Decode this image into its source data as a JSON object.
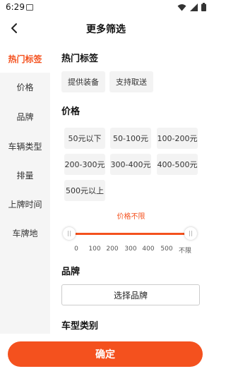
{
  "status": {
    "time": "6:29"
  },
  "header": {
    "title": "更多筛选"
  },
  "sidebar": {
    "items": [
      {
        "label": "热门标签",
        "active": true
      },
      {
        "label": "价格"
      },
      {
        "label": "品牌"
      },
      {
        "label": "车辆类型"
      },
      {
        "label": "排量"
      },
      {
        "label": "上牌时间"
      },
      {
        "label": "车牌地"
      }
    ]
  },
  "hot_tags": {
    "title": "热门标签",
    "tags": [
      "提供装备",
      "支持取送"
    ]
  },
  "price": {
    "title": "价格",
    "options": [
      "50元以下",
      "50-100元",
      "100-200元",
      "200-300元",
      "300-400元",
      "400-500元",
      "500元以上"
    ],
    "range_note": "价格不限",
    "slider_ticks": [
      "0",
      "100",
      "200",
      "300",
      "400",
      "500",
      "不限"
    ],
    "slider_selected_min": "0",
    "slider_selected_max": "不限"
  },
  "brand": {
    "title": "品牌",
    "button_label": "选择品牌"
  },
  "vehicle_type": {
    "title": "车型类别"
  },
  "footer": {
    "confirm_label": "确定"
  },
  "colors": {
    "accent": "#f4511e",
    "sidebar_bg": "#f5f5f5",
    "tag_bg": "#f3f3f3"
  }
}
